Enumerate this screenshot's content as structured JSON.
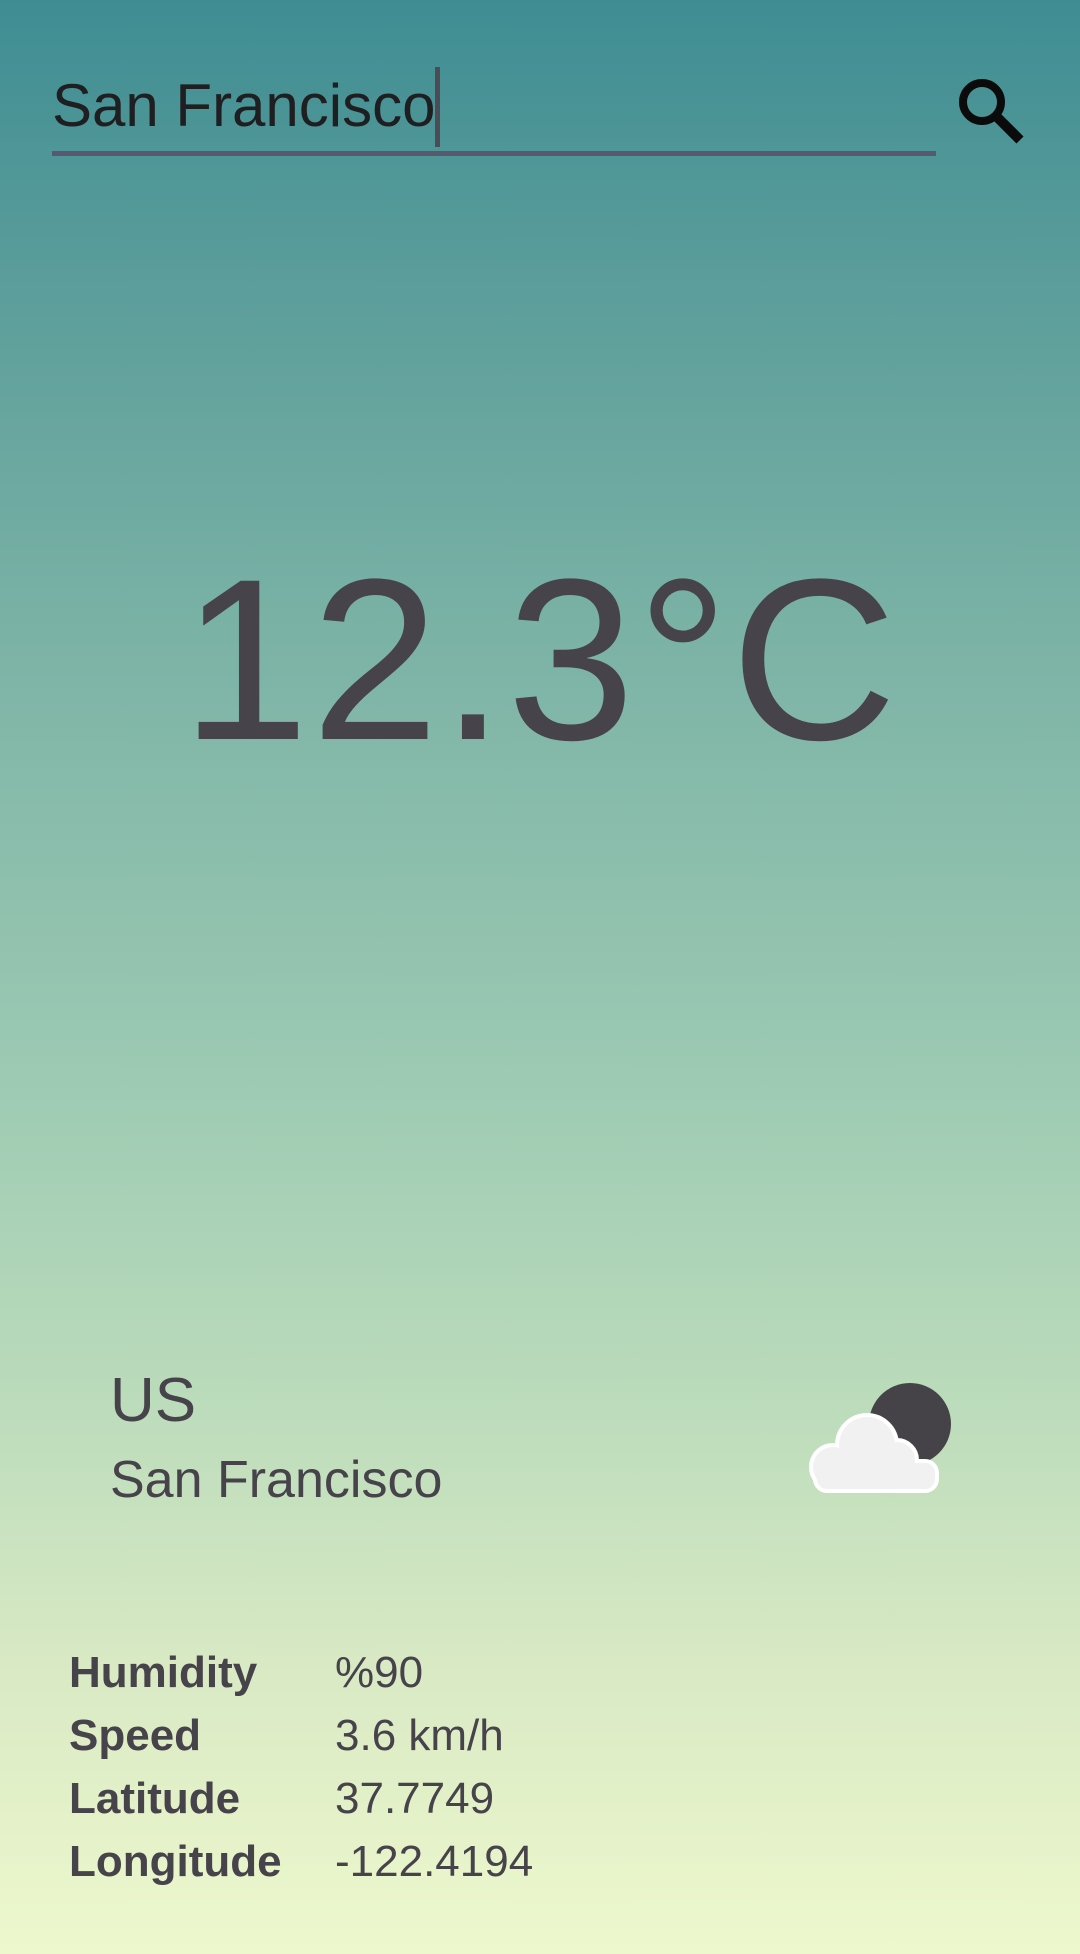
{
  "search": {
    "value": "San Francisco",
    "placeholder": ""
  },
  "icons": {
    "search": "search-icon",
    "weather": "cloud-night-icon"
  },
  "current": {
    "temperature": "12.3°C",
    "country": "US",
    "city": "San Francisco"
  },
  "details": [
    {
      "label": "Humidity",
      "value": "%90"
    },
    {
      "label": "Speed",
      "value": "3.6 km/h"
    },
    {
      "label": "Latitude",
      "value": "37.7749"
    },
    {
      "label": "Longitude",
      "value": "-122.4194"
    }
  ],
  "colors": {
    "gradient_top": "#3f8d93",
    "gradient_bottom": "#eef8cd",
    "text": "#47434b",
    "underline": "#5a586e"
  }
}
